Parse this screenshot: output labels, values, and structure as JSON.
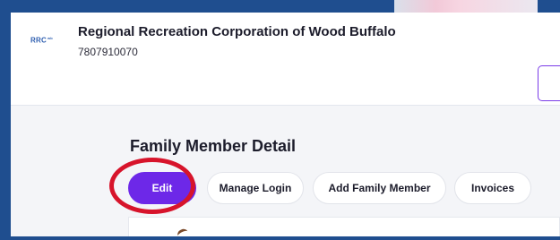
{
  "header": {
    "logo_text": "RRC",
    "logo_sup": "wb",
    "org_name": "Regional Recreation Corporation of Wood Buffalo",
    "phone": "7807910070"
  },
  "main": {
    "title": "Family Member Detail",
    "tabs": [
      {
        "label": "Edit",
        "active": true
      },
      {
        "label": "Manage Login",
        "active": false
      },
      {
        "label": "Add Family Member",
        "active": false
      },
      {
        "label": "Invoices",
        "active": false
      }
    ]
  },
  "colors": {
    "frame": "#1f4e8f",
    "accent": "#6d28e8",
    "highlight": "#d7142b"
  }
}
